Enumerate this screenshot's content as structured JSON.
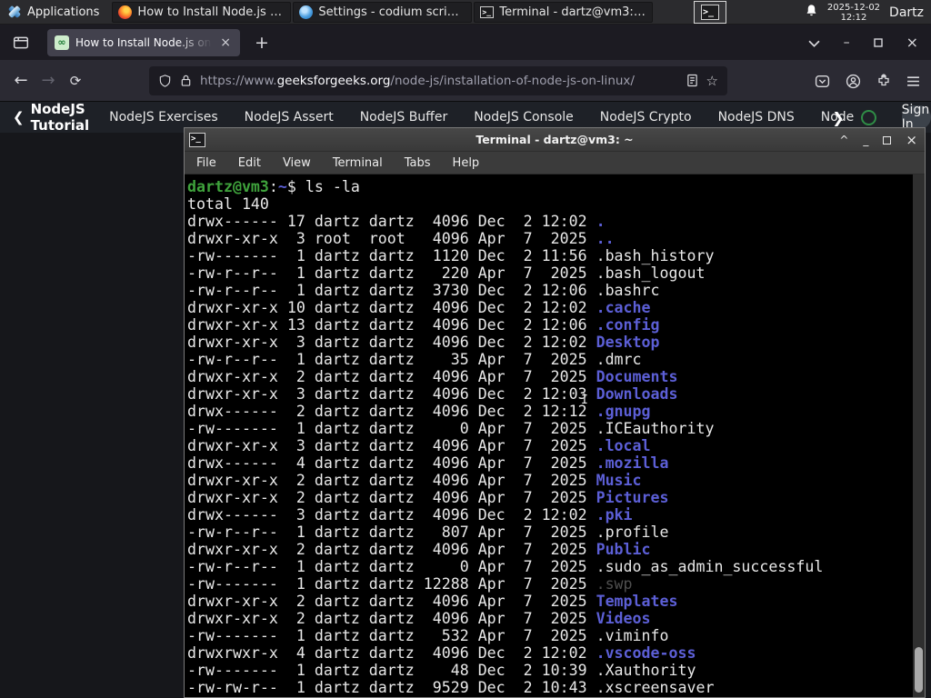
{
  "panel": {
    "applications_label": "Applications",
    "windows": [
      {
        "icon": "firefox-icon",
        "label": "How to Install Node.js o..."
      },
      {
        "icon": "codium-icon",
        "label": "Settings - codium script..."
      },
      {
        "icon": "terminal-icon",
        "label": "Terminal - dartz@vm3: ~"
      }
    ],
    "clock_date": "2025-12-02",
    "clock_time": "12:12",
    "user": "Dartz"
  },
  "browser": {
    "tab_title": "How to Install Node.js on...",
    "favicon_glyph": "∞",
    "close_glyph": "×",
    "new_tab_glyph": "+",
    "url_prefix": "https://www.",
    "url_domain": "geeksforgeeks.org",
    "url_path": "/node-js/installation-of-node-js-on-linux/"
  },
  "sitenav": {
    "back_chevron": "❮",
    "back_label": "NodeJS Tutorial",
    "items": [
      "NodeJS Exercises",
      "NodeJS Assert",
      "NodeJS Buffer",
      "NodeJS Console",
      "NodeJS Crypto",
      "NodeJS DNS",
      "Node"
    ],
    "more_chevron": "❯",
    "sign_in_label": "Sign In"
  },
  "terminal": {
    "title": "Terminal - dartz@vm3: ~",
    "menu": [
      "File",
      "Edit",
      "View",
      "Terminal",
      "Tabs",
      "Help"
    ],
    "shade_glyph": "^",
    "minimize_glyph": "_",
    "close_glyph": "×",
    "prompt": {
      "user_host": "dartz@vm3",
      "colon": ":",
      "path": "~",
      "rest": "$ ls -la"
    },
    "total_line": "total 140",
    "listing": [
      {
        "pre": "drwx------ 17 dartz dartz  4096 Dec  2 12:02 ",
        "name": ".",
        "kind": "dir"
      },
      {
        "pre": "drwxr-xr-x  3 root  root   4096 Apr  7  2025 ",
        "name": "..",
        "kind": "dir"
      },
      {
        "pre": "-rw-------  1 dartz dartz  1120 Dec  2 11:56 ",
        "name": ".bash_history",
        "kind": "file"
      },
      {
        "pre": "-rw-r--r--  1 dartz dartz   220 Apr  7  2025 ",
        "name": ".bash_logout",
        "kind": "file"
      },
      {
        "pre": "-rw-r--r--  1 dartz dartz  3730 Dec  2 12:06 ",
        "name": ".bashrc",
        "kind": "file"
      },
      {
        "pre": "drwxr-xr-x 10 dartz dartz  4096 Dec  2 12:02 ",
        "name": ".cache",
        "kind": "dir"
      },
      {
        "pre": "drwxr-xr-x 13 dartz dartz  4096 Dec  2 12:06 ",
        "name": ".config",
        "kind": "dir"
      },
      {
        "pre": "drwxr-xr-x  3 dartz dartz  4096 Dec  2 12:02 ",
        "name": "Desktop",
        "kind": "dir"
      },
      {
        "pre": "-rw-r--r--  1 dartz dartz    35 Apr  7  2025 ",
        "name": ".dmrc",
        "kind": "file"
      },
      {
        "pre": "drwxr-xr-x  2 dartz dartz  4096 Apr  7  2025 ",
        "name": "Documents",
        "kind": "dir"
      },
      {
        "pre": "drwxr-xr-x  3 dartz dartz  4096 Dec  2 12:03 ",
        "name": "Downloads",
        "kind": "dir"
      },
      {
        "pre": "drwx------  2 dartz dartz  4096 Dec  2 12:12 ",
        "name": ".gnupg",
        "kind": "dir"
      },
      {
        "pre": "-rw-------  1 dartz dartz     0 Apr  7  2025 ",
        "name": ".ICEauthority",
        "kind": "file"
      },
      {
        "pre": "drwxr-xr-x  3 dartz dartz  4096 Apr  7  2025 ",
        "name": ".local",
        "kind": "dir"
      },
      {
        "pre": "drwx------  4 dartz dartz  4096 Apr  7  2025 ",
        "name": ".mozilla",
        "kind": "dir"
      },
      {
        "pre": "drwxr-xr-x  2 dartz dartz  4096 Apr  7  2025 ",
        "name": "Music",
        "kind": "dir"
      },
      {
        "pre": "drwxr-xr-x  2 dartz dartz  4096 Apr  7  2025 ",
        "name": "Pictures",
        "kind": "dir"
      },
      {
        "pre": "drwx------  3 dartz dartz  4096 Dec  2 12:02 ",
        "name": ".pki",
        "kind": "dir"
      },
      {
        "pre": "-rw-r--r--  1 dartz dartz   807 Apr  7  2025 ",
        "name": ".profile",
        "kind": "file"
      },
      {
        "pre": "drwxr-xr-x  2 dartz dartz  4096 Apr  7  2025 ",
        "name": "Public",
        "kind": "dir"
      },
      {
        "pre": "-rw-r--r--  1 dartz dartz     0 Apr  7  2025 ",
        "name": ".sudo_as_admin_successful",
        "kind": "file"
      },
      {
        "pre": "-rw-------  1 dartz dartz 12288 Apr  7  2025 ",
        "name": ".swp",
        "kind": "dim"
      },
      {
        "pre": "drwxr-xr-x  2 dartz dartz  4096 Apr  7  2025 ",
        "name": "Templates",
        "kind": "dir"
      },
      {
        "pre": "drwxr-xr-x  2 dartz dartz  4096 Apr  7  2025 ",
        "name": "Videos",
        "kind": "dir"
      },
      {
        "pre": "-rw-------  1 dartz dartz   532 Apr  7  2025 ",
        "name": ".viminfo",
        "kind": "file"
      },
      {
        "pre": "drwxrwxr-x  4 dartz dartz  4096 Dec  2 12:02 ",
        "name": ".vscode-oss",
        "kind": "dir"
      },
      {
        "pre": "-rw-------  1 dartz dartz    48 Dec  2 10:39 ",
        "name": ".Xauthority",
        "kind": "file"
      },
      {
        "pre": "-rw-rw-r--  1 dartz dartz  9529 Dec  2 10:43 ",
        "name": ".xscreensaver",
        "kind": "file"
      }
    ]
  },
  "colors": {
    "dir_blue": "#5c5fd6",
    "prompt_green": "#3fa33c",
    "gfg_green": "#2f8d46"
  }
}
